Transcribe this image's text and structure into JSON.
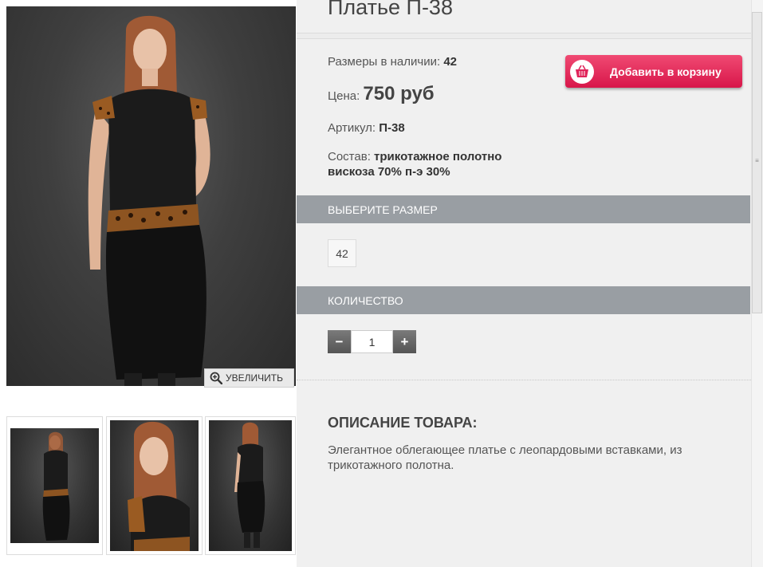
{
  "product": {
    "title": "Платье П-38",
    "sizes_label": "Размеры в наличии:",
    "sizes_value": "42",
    "price_label": "Цена:",
    "price_value": "750 руб",
    "sku_label": "Артикул:",
    "sku_value": "П-38",
    "composition_label": "Состав:",
    "composition_line1": "трикотажное полотно",
    "composition_line2": "вискоза 70% п-э 30%"
  },
  "actions": {
    "add_to_cart": "Добавить в корзину",
    "zoom": "УВЕЛИЧИТЬ"
  },
  "size_section": {
    "heading": "ВЫБЕРИТЕ РАЗМЕР",
    "options": [
      "42"
    ]
  },
  "quantity_section": {
    "heading": "КОЛИЧЕСТВО",
    "minus": "−",
    "plus": "+",
    "value": "1"
  },
  "description": {
    "heading": "ОПИСАНИЕ ТОВАРА:",
    "text": "Элегантное облегающее платье с леопардовыми  вставками, из трикотажного полотна."
  },
  "icons": {
    "zoom": "magnifier-plus-icon",
    "cart": "shopping-basket-icon"
  },
  "colors": {
    "cart_button": "#e0245a",
    "section_bar": "#999ea3",
    "panel_bg": "#f0f0f0"
  }
}
